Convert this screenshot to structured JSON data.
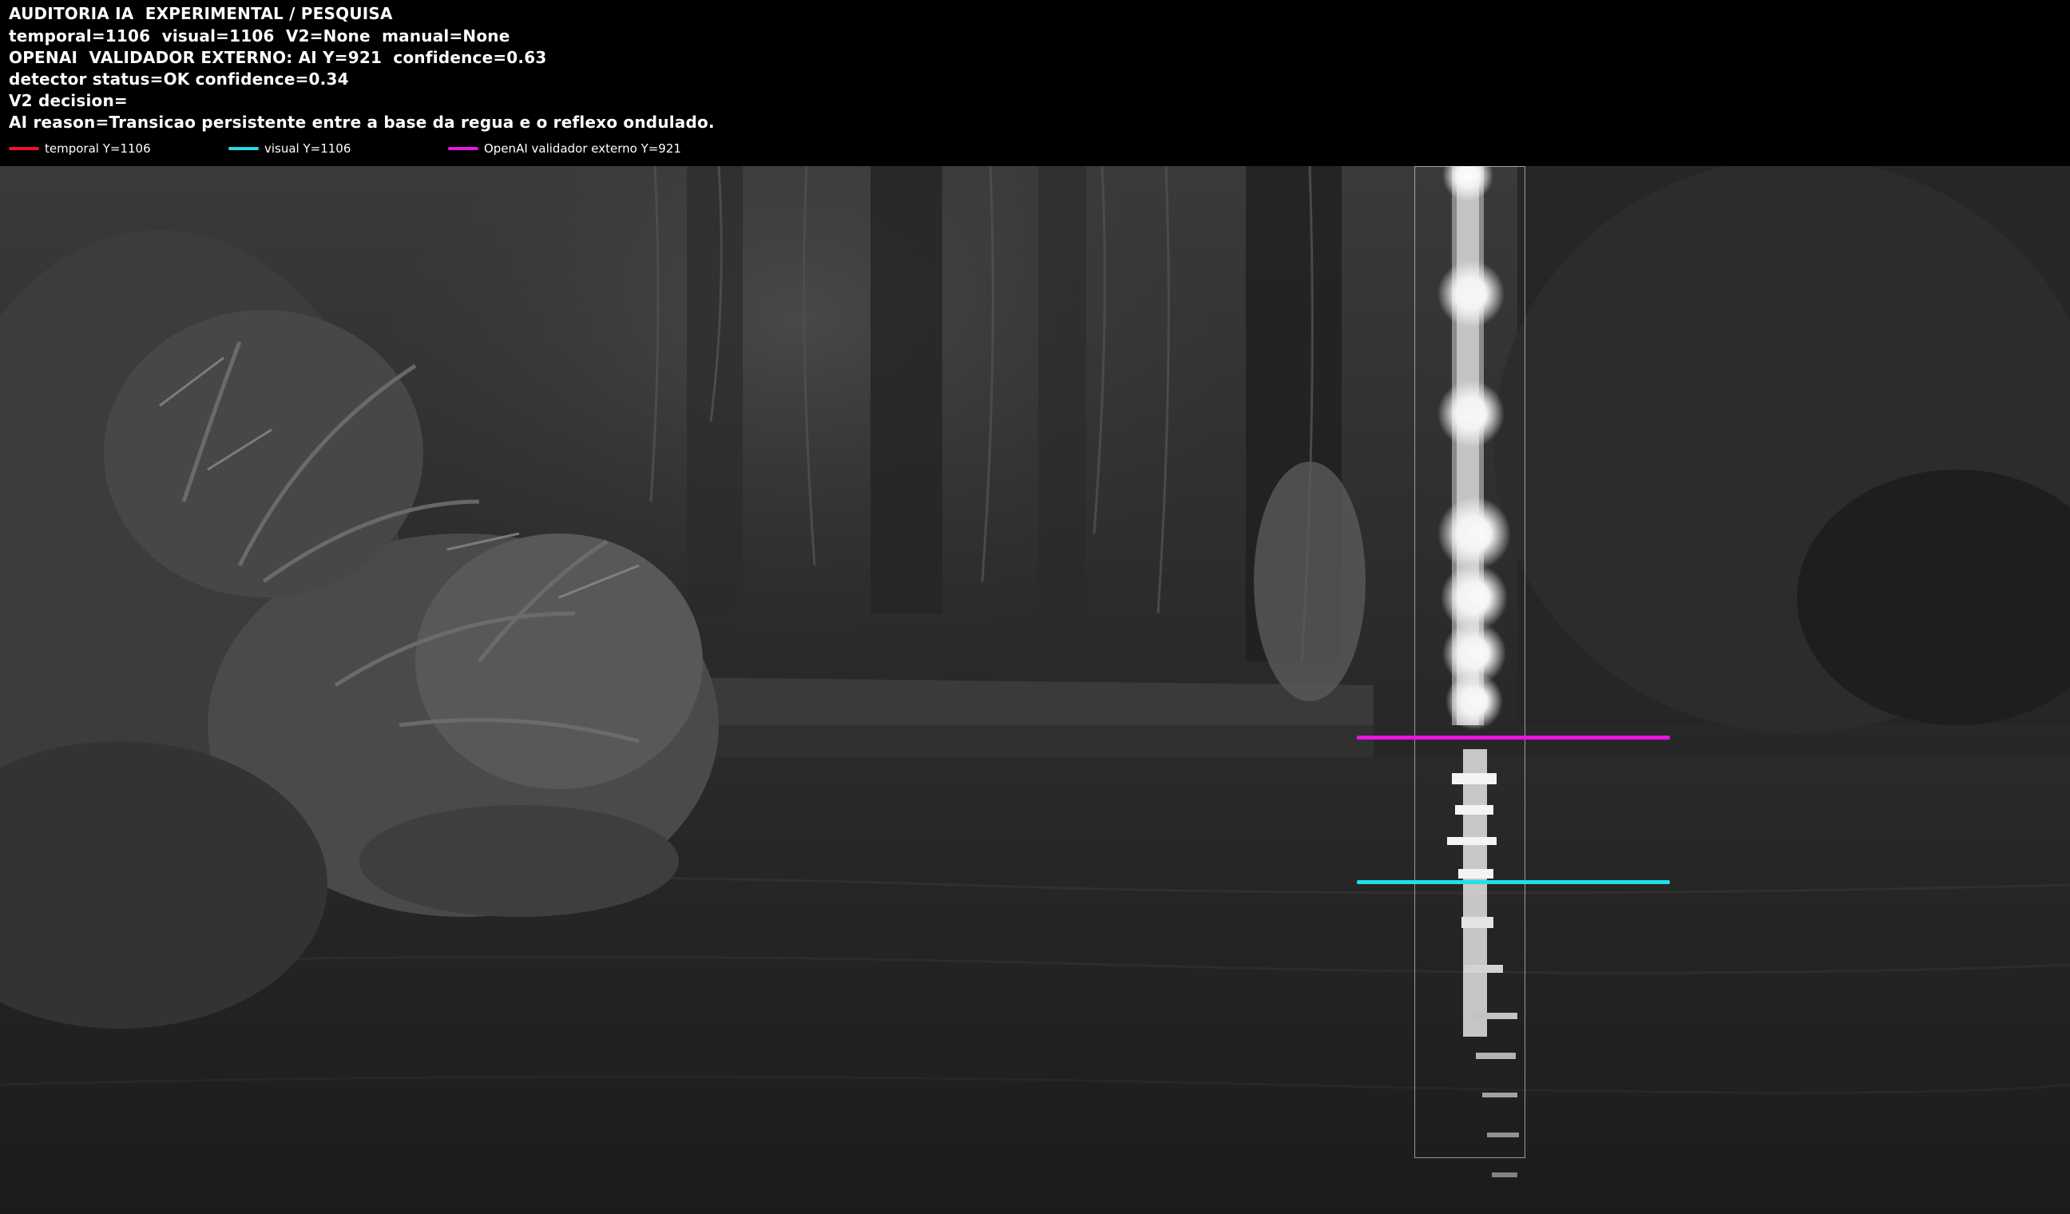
{
  "header": {
    "lines": [
      "AUDITORIA IA  EXPERIMENTAL / PESQUISA",
      "temporal=1106  visual=1106  V2=None  manual=None",
      "OPENAI  VALIDADOR EXTERNO: AI Y=921  confidence=0.63",
      "detector status=OK confidence=0.34",
      "V2 decision=",
      "AI reason=Transicao persistente entre a base da regua e o reflexo ondulado."
    ]
  },
  "legend": [
    {
      "label": "temporal Y=1106",
      "color": "#e8161e"
    },
    {
      "label": "visual Y=1106",
      "color": "#1fe0e6"
    },
    {
      "label": "OpenAI validador externo Y=921",
      "color": "#e816e0"
    }
  ],
  "lines": {
    "openai_color": "#e816e0",
    "visual_color": "#1fe0e6",
    "temporal_color": "#e8161e"
  },
  "scene": {
    "description_icon": "night-ir-camera-river-scene"
  }
}
